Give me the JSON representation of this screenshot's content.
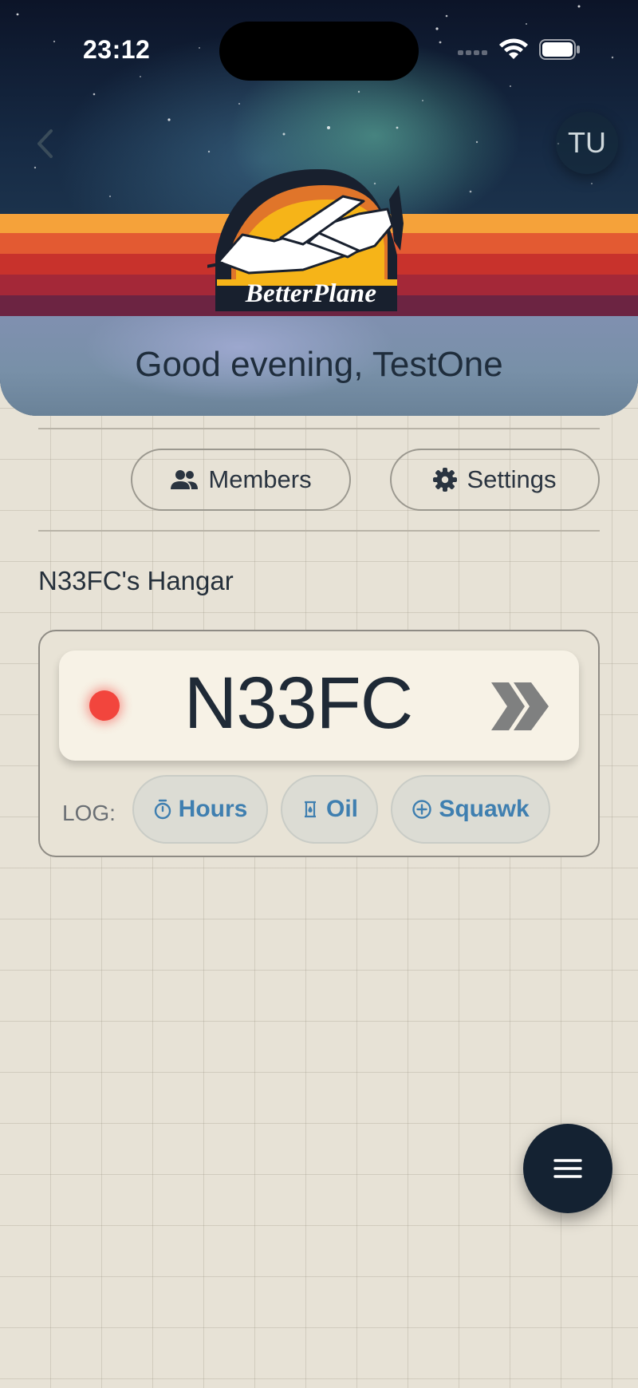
{
  "status_bar": {
    "time": "23:12",
    "icons": [
      "cellular-icon",
      "wifi-icon",
      "battery-icon"
    ]
  },
  "header": {
    "back_icon": "chevron-left-icon",
    "avatar_initials": "TU",
    "logo_text": "BetterPlane",
    "greeting": "Good evening, TestOne"
  },
  "actions": {
    "members_label": "Members",
    "members_icon": "people-icon",
    "settings_label": "Settings",
    "settings_icon": "gear-icon"
  },
  "hangar": {
    "title": "N33FC's Hangar",
    "aircraft": [
      {
        "tail_number": "N33FC",
        "status_color": "#f2453d",
        "open_icon": "double-chevron-right-icon",
        "log_label": "LOG:",
        "log_actions": [
          {
            "label": "Hours",
            "icon": "stopwatch-icon"
          },
          {
            "label": "Oil",
            "icon": "oil-icon"
          },
          {
            "label": "Squawk",
            "icon": "plus-circle-icon"
          }
        ]
      }
    ]
  },
  "fab": {
    "icon": "menu-icon"
  },
  "colors": {
    "background": "#e7e2d6",
    "accent": "#3f7fb0",
    "dark": "#142232",
    "status_red": "#f2453d"
  }
}
